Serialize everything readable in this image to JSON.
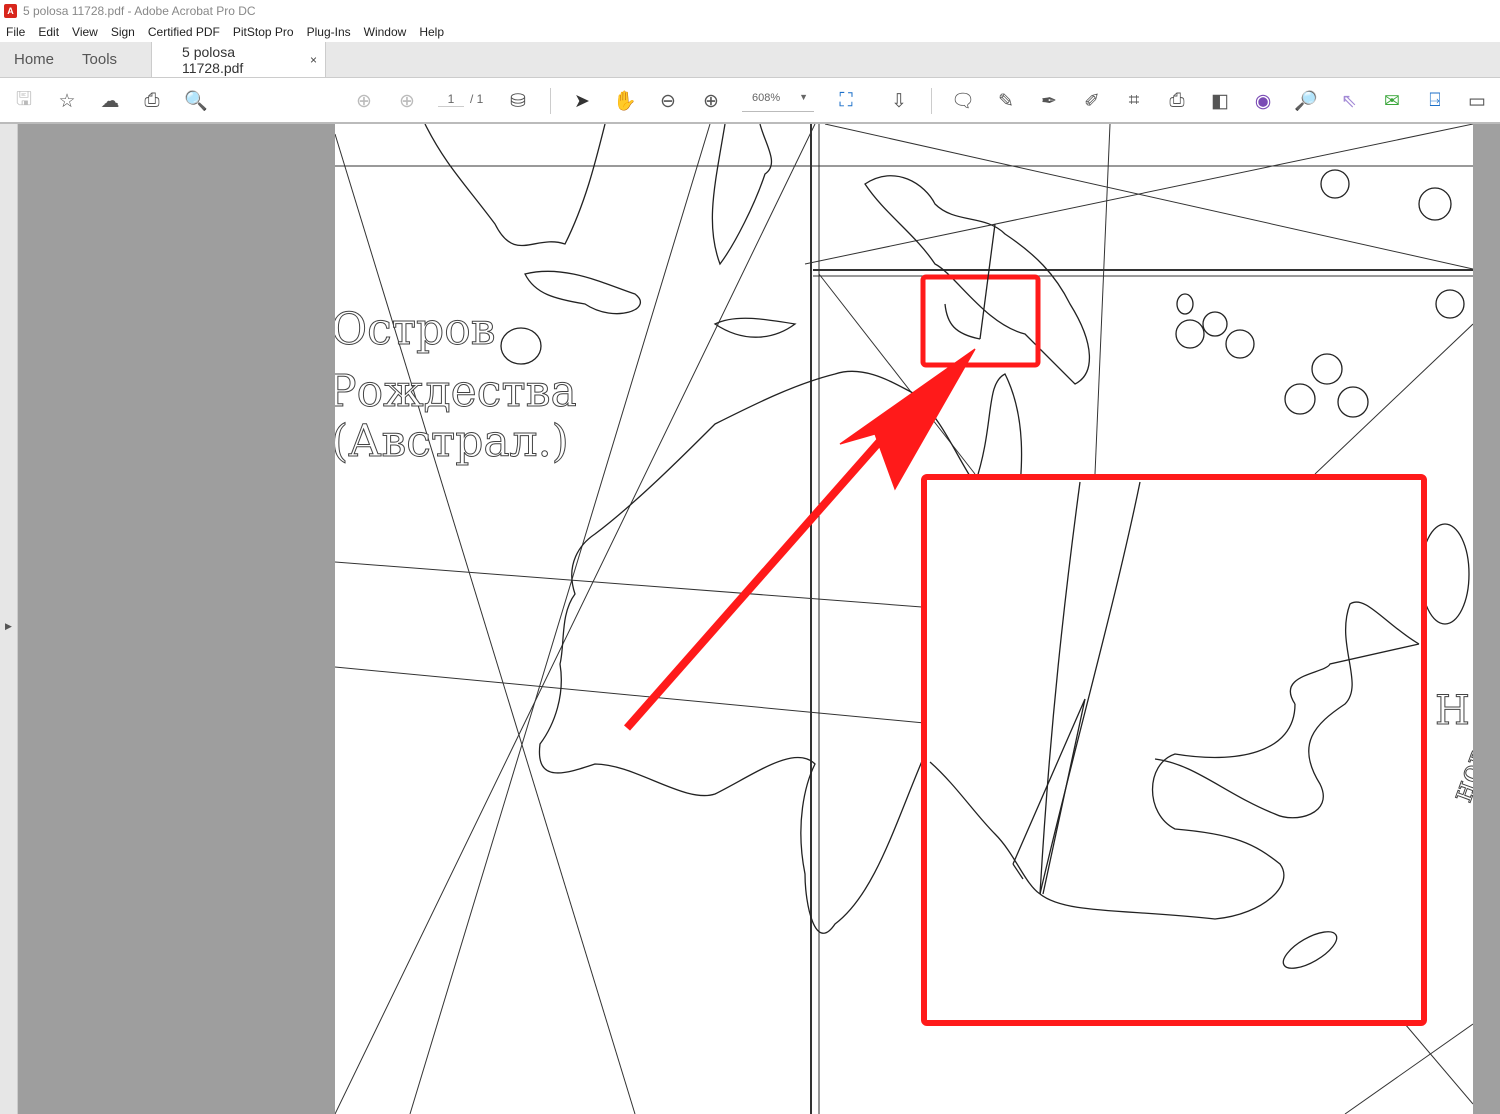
{
  "window": {
    "title": "5 polosa 11728.pdf - Adobe Acrobat Pro DC",
    "icon": "acrobat-icon"
  },
  "menu": [
    "File",
    "Edit",
    "View",
    "Sign",
    "Certified PDF",
    "PitStop Pro",
    "Plug-Ins",
    "Window",
    "Help"
  ],
  "tabs": {
    "home": "Home",
    "tools": "Tools",
    "document": "5 polosa 11728.pdf",
    "close": "×"
  },
  "toolbar": {
    "page_current": "1",
    "page_total": "/ 1",
    "zoom": "608%"
  },
  "map": {
    "label_line1": "Остров",
    "label_line2": "Рождества",
    "label_line3": "(Австрал.)",
    "edge_text1": "Н",
    "edge_text2": "нов"
  },
  "colors": {
    "highlight": "#ff1a1a",
    "page": "#ffffff",
    "background": "#9e9e9e"
  }
}
